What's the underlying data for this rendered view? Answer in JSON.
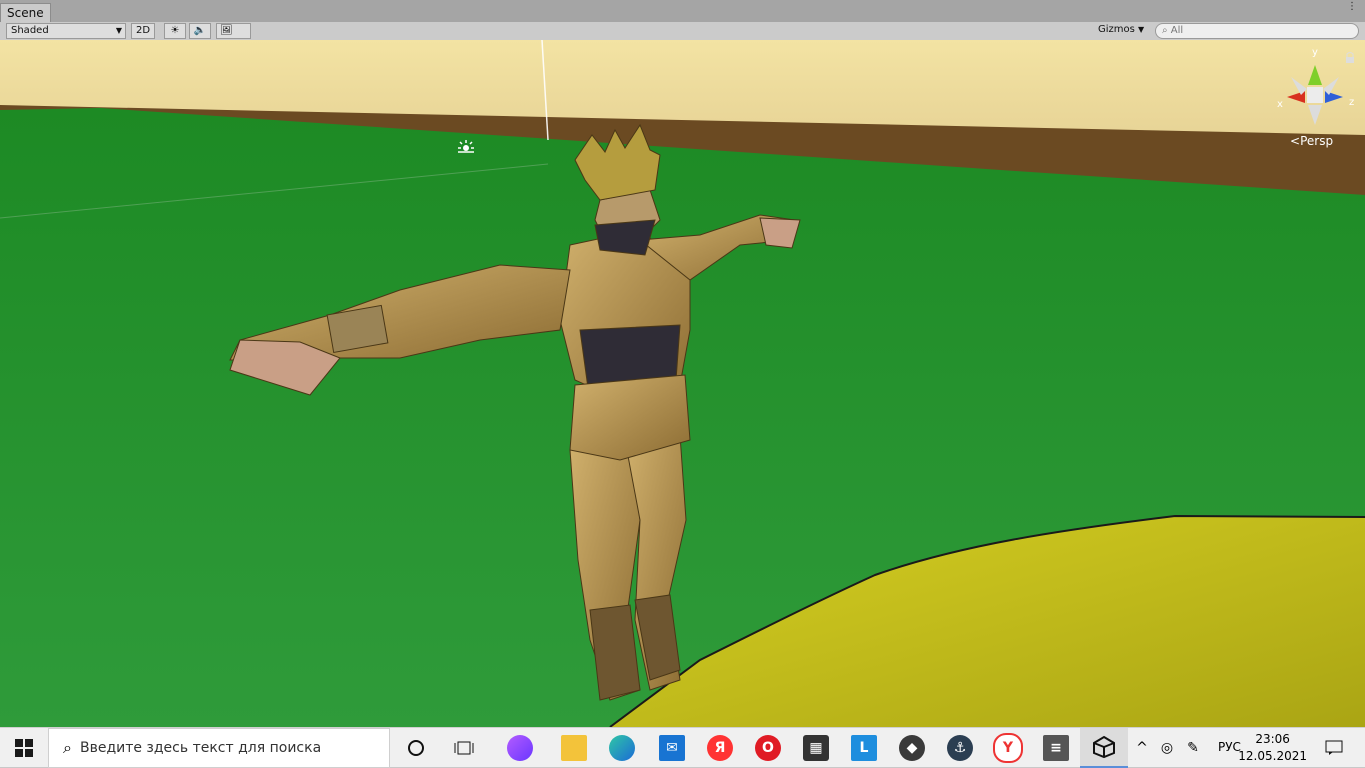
{
  "window": {
    "tab_title": "Scene",
    "menu_glyph": "⋮"
  },
  "toolbar": {
    "shading_mode": "Shaded",
    "toggle_2d": "2D",
    "gizmos_label": "Gizmos",
    "search_placeholder": "All"
  },
  "viewport": {
    "projection_label": "Persp",
    "axes": {
      "x": "x",
      "y": "y",
      "z": "z"
    },
    "colors": {
      "sky_top": "#f3e3a3",
      "horizon": "#7b5a2b",
      "ground": "#1d8a24",
      "platform": "#c9c21c",
      "character_skin": "#b8944f"
    }
  },
  "taskbar": {
    "search_placeholder": "Введите здесь текст для поиска",
    "apps": [
      "cortana-icon",
      "task-view-icon",
      "alice-icon",
      "file-explorer-icon",
      "edge-icon",
      "mail-icon",
      "yandex-icon",
      "opera-icon",
      "store-icon",
      "l-app-icon",
      "world-of-tanks-icon",
      "world-of-warships-icon",
      "yandex-browser-icon",
      "archive-icon",
      "unity-icon"
    ],
    "language": "РУС",
    "time": "23:06",
    "date": "12.05.2021"
  }
}
